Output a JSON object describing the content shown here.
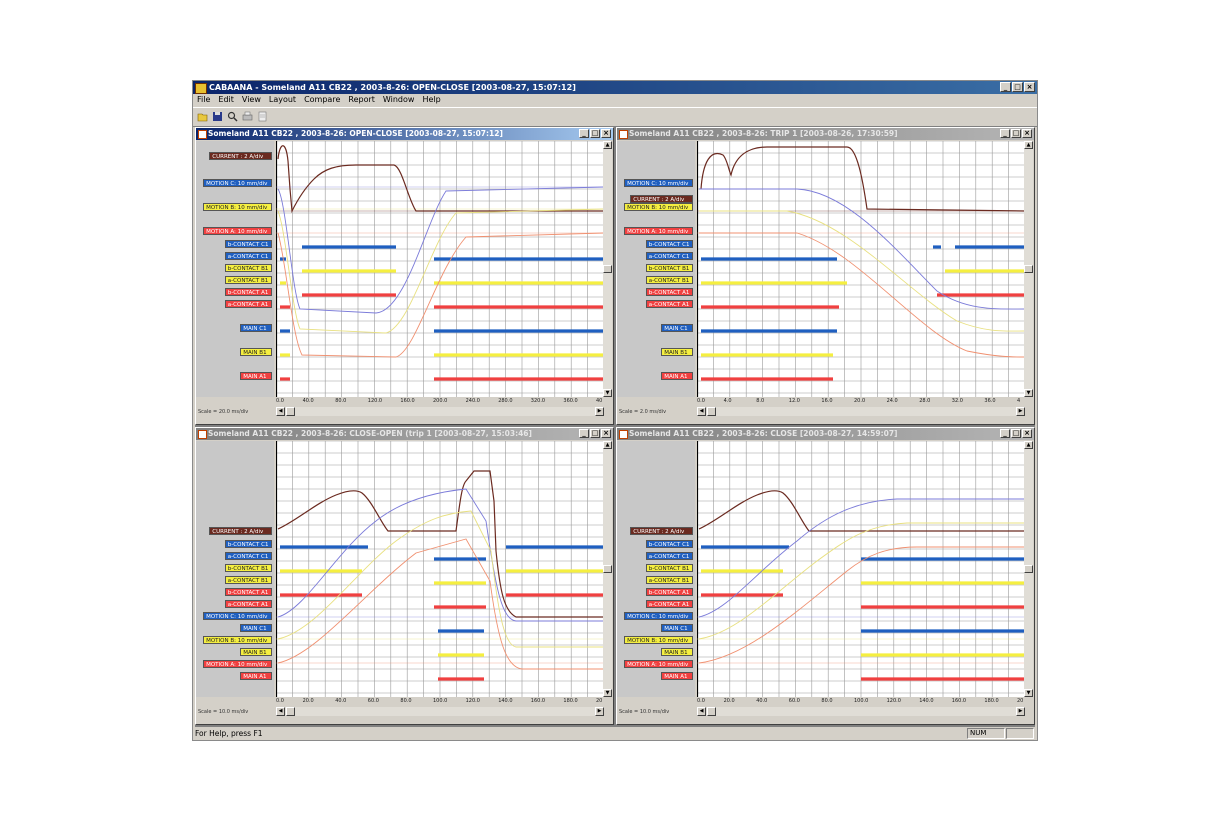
{
  "app": {
    "title": "CABAANA - Someland A11 CB22 , 2003-8-26: OPEN-CLOSE  [2003-08-27, 15:07:12]",
    "menu": [
      "File",
      "Edit",
      "View",
      "Layout",
      "Compare",
      "Report",
      "Window",
      "Help"
    ],
    "toolbar_icons": [
      "open-icon",
      "save-icon",
      "zoom-icon",
      "print-icon",
      "print-preview-icon"
    ],
    "status_text": "For Help, press F1",
    "status_num": "NUM"
  },
  "colors": {
    "blue": "#1f5fc0",
    "yellow": "#f5ef40",
    "red": "#f04040",
    "current": "#6b2a20",
    "motion_c": "#7b7bd9",
    "motion_b": "#e8e080",
    "motion_a": "#f09070"
  },
  "windows": [
    {
      "title": "Someland A11 CB22 , 2003-8-26: OPEN-CLOSE  [2003-08-27, 15:07:12]",
      "active": true,
      "scale": "Scale = 20.0 ms/div",
      "ticks": [
        "0.0",
        "40.0",
        "80.0",
        "120.0",
        "160.0",
        "200.0",
        "240.0",
        "280.0",
        "320.0",
        "360.0",
        "40"
      ],
      "labels": [
        {
          "text": "CURRENT : 2 A/div",
          "color": "current"
        },
        {
          "text": "MOTION C: 10 mm/div",
          "color": "blue"
        },
        {
          "text": "MOTION B: 10 mm/div",
          "color": "yellow"
        },
        {
          "text": "MOTION A: 10 mm/div",
          "color": "red"
        },
        {
          "text": "b-CONTACT C1",
          "color": "blue"
        },
        {
          "text": "a-CONTACT C1",
          "color": "blue"
        },
        {
          "text": "b-CONTACT B1",
          "color": "yellow"
        },
        {
          "text": "a-CONTACT B1",
          "color": "yellow"
        },
        {
          "text": "b-CONTACT A1",
          "color": "red"
        },
        {
          "text": "a-CONTACT A1",
          "color": "red"
        },
        {
          "text": "MAIN C1",
          "color": "blue"
        },
        {
          "text": "MAIN B1",
          "color": "yellow"
        },
        {
          "text": "MAIN A1",
          "color": "red"
        }
      ]
    },
    {
      "title": "Someland A11 CB22 , 2003-8-26: TRIP 1  [2003-08-26, 17:30:59]",
      "active": false,
      "scale": "Scale = 2.0 ms/div",
      "ticks": [
        "0.0",
        "4.0",
        "8.0",
        "12.0",
        "16.0",
        "20.0",
        "24.0",
        "28.0",
        "32.0",
        "36.0",
        "4"
      ],
      "labels": [
        {
          "text": "MOTION C: 10 mm/div",
          "color": "blue"
        },
        {
          "text": "CURRENT : 2 A/div",
          "color": "current"
        },
        {
          "text": "MOTION B: 10 mm/div",
          "color": "yellow"
        },
        {
          "text": "MOTION A: 10 mm/div",
          "color": "red"
        },
        {
          "text": "b-CONTACT C1",
          "color": "blue"
        },
        {
          "text": "a-CONTACT C1",
          "color": "blue"
        },
        {
          "text": "b-CONTACT B1",
          "color": "yellow"
        },
        {
          "text": "a-CONTACT B1",
          "color": "yellow"
        },
        {
          "text": "b-CONTACT A1",
          "color": "red"
        },
        {
          "text": "a-CONTACT A1",
          "color": "red"
        },
        {
          "text": "MAIN C1",
          "color": "blue"
        },
        {
          "text": "MAIN B1",
          "color": "yellow"
        },
        {
          "text": "MAIN A1",
          "color": "red"
        }
      ]
    },
    {
      "title": "Someland A11 CB22 , 2003-8-26: CLOSE-OPEN (trip 1  [2003-08-27, 15:03:46]",
      "active": false,
      "scale": "Scale = 10.0 ms/div",
      "ticks": [
        "0.0",
        "20.0",
        "40.0",
        "60.0",
        "80.0",
        "100.0",
        "120.0",
        "140.0",
        "160.0",
        "180.0",
        "20"
      ],
      "labels": [
        {
          "text": "CURRENT : 2 A/div",
          "color": "current"
        },
        {
          "text": "b-CONTACT C1",
          "color": "blue"
        },
        {
          "text": "a-CONTACT C1",
          "color": "blue"
        },
        {
          "text": "b-CONTACT B1",
          "color": "yellow"
        },
        {
          "text": "a-CONTACT B1",
          "color": "yellow"
        },
        {
          "text": "b-CONTACT A1",
          "color": "red"
        },
        {
          "text": "a-CONTACT A1",
          "color": "red"
        },
        {
          "text": "MOTION C: 10 mm/div",
          "color": "blue"
        },
        {
          "text": "MAIN C1",
          "color": "blue"
        },
        {
          "text": "MOTION B: 10 mm/div",
          "color": "yellow"
        },
        {
          "text": "MAIN B1",
          "color": "yellow"
        },
        {
          "text": "MOTION A: 10 mm/div",
          "color": "red"
        },
        {
          "text": "MAIN A1",
          "color": "red"
        }
      ]
    },
    {
      "title": "Someland A11 CB22 , 2003-8-26: CLOSE  [2003-08-27, 14:59:07]",
      "active": false,
      "scale": "Scale = 10.0 ms/div",
      "ticks": [
        "0.0",
        "20.0",
        "40.0",
        "60.0",
        "80.0",
        "100.0",
        "120.0",
        "140.0",
        "160.0",
        "180.0",
        "20"
      ],
      "labels": [
        {
          "text": "CURRENT : 2 A/div",
          "color": "current"
        },
        {
          "text": "b-CONTACT C1",
          "color": "blue"
        },
        {
          "text": "a-CONTACT C1",
          "color": "blue"
        },
        {
          "text": "b-CONTACT B1",
          "color": "yellow"
        },
        {
          "text": "a-CONTACT B1",
          "color": "yellow"
        },
        {
          "text": "b-CONTACT A1",
          "color": "red"
        },
        {
          "text": "a-CONTACT A1",
          "color": "red"
        },
        {
          "text": "MOTION C: 10 mm/div",
          "color": "blue"
        },
        {
          "text": "MAIN C1",
          "color": "blue"
        },
        {
          "text": "MOTION B: 10 mm/div",
          "color": "yellow"
        },
        {
          "text": "MAIN B1",
          "color": "yellow"
        },
        {
          "text": "MOTION A: 10 mm/div",
          "color": "red"
        },
        {
          "text": "MAIN A1",
          "color": "red"
        }
      ]
    }
  ]
}
